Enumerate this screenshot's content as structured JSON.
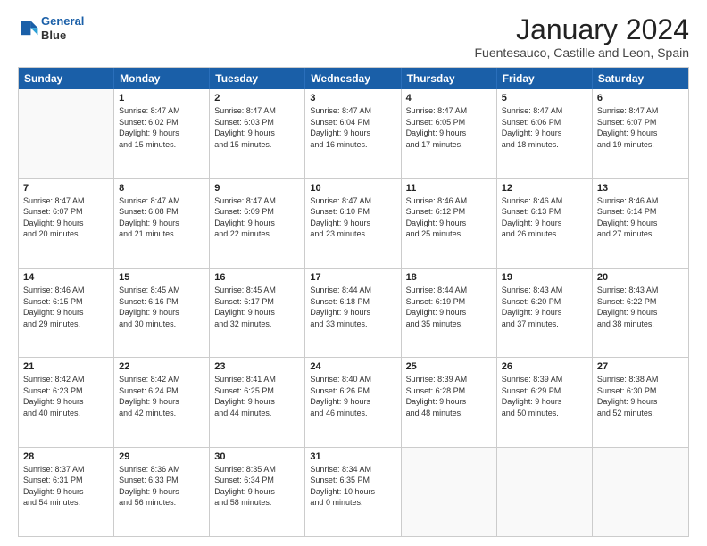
{
  "logo": {
    "line1": "General",
    "line2": "Blue"
  },
  "title": "January 2024",
  "subtitle": "Fuentesauco, Castille and Leon, Spain",
  "weekdays": [
    "Sunday",
    "Monday",
    "Tuesday",
    "Wednesday",
    "Thursday",
    "Friday",
    "Saturday"
  ],
  "rows": [
    [
      {
        "day": "",
        "info": ""
      },
      {
        "day": "1",
        "info": "Sunrise: 8:47 AM\nSunset: 6:02 PM\nDaylight: 9 hours\nand 15 minutes."
      },
      {
        "day": "2",
        "info": "Sunrise: 8:47 AM\nSunset: 6:03 PM\nDaylight: 9 hours\nand 15 minutes."
      },
      {
        "day": "3",
        "info": "Sunrise: 8:47 AM\nSunset: 6:04 PM\nDaylight: 9 hours\nand 16 minutes."
      },
      {
        "day": "4",
        "info": "Sunrise: 8:47 AM\nSunset: 6:05 PM\nDaylight: 9 hours\nand 17 minutes."
      },
      {
        "day": "5",
        "info": "Sunrise: 8:47 AM\nSunset: 6:06 PM\nDaylight: 9 hours\nand 18 minutes."
      },
      {
        "day": "6",
        "info": "Sunrise: 8:47 AM\nSunset: 6:07 PM\nDaylight: 9 hours\nand 19 minutes."
      }
    ],
    [
      {
        "day": "7",
        "info": "Sunrise: 8:47 AM\nSunset: 6:07 PM\nDaylight: 9 hours\nand 20 minutes."
      },
      {
        "day": "8",
        "info": "Sunrise: 8:47 AM\nSunset: 6:08 PM\nDaylight: 9 hours\nand 21 minutes."
      },
      {
        "day": "9",
        "info": "Sunrise: 8:47 AM\nSunset: 6:09 PM\nDaylight: 9 hours\nand 22 minutes."
      },
      {
        "day": "10",
        "info": "Sunrise: 8:47 AM\nSunset: 6:10 PM\nDaylight: 9 hours\nand 23 minutes."
      },
      {
        "day": "11",
        "info": "Sunrise: 8:46 AM\nSunset: 6:12 PM\nDaylight: 9 hours\nand 25 minutes."
      },
      {
        "day": "12",
        "info": "Sunrise: 8:46 AM\nSunset: 6:13 PM\nDaylight: 9 hours\nand 26 minutes."
      },
      {
        "day": "13",
        "info": "Sunrise: 8:46 AM\nSunset: 6:14 PM\nDaylight: 9 hours\nand 27 minutes."
      }
    ],
    [
      {
        "day": "14",
        "info": "Sunrise: 8:46 AM\nSunset: 6:15 PM\nDaylight: 9 hours\nand 29 minutes."
      },
      {
        "day": "15",
        "info": "Sunrise: 8:45 AM\nSunset: 6:16 PM\nDaylight: 9 hours\nand 30 minutes."
      },
      {
        "day": "16",
        "info": "Sunrise: 8:45 AM\nSunset: 6:17 PM\nDaylight: 9 hours\nand 32 minutes."
      },
      {
        "day": "17",
        "info": "Sunrise: 8:44 AM\nSunset: 6:18 PM\nDaylight: 9 hours\nand 33 minutes."
      },
      {
        "day": "18",
        "info": "Sunrise: 8:44 AM\nSunset: 6:19 PM\nDaylight: 9 hours\nand 35 minutes."
      },
      {
        "day": "19",
        "info": "Sunrise: 8:43 AM\nSunset: 6:20 PM\nDaylight: 9 hours\nand 37 minutes."
      },
      {
        "day": "20",
        "info": "Sunrise: 8:43 AM\nSunset: 6:22 PM\nDaylight: 9 hours\nand 38 minutes."
      }
    ],
    [
      {
        "day": "21",
        "info": "Sunrise: 8:42 AM\nSunset: 6:23 PM\nDaylight: 9 hours\nand 40 minutes."
      },
      {
        "day": "22",
        "info": "Sunrise: 8:42 AM\nSunset: 6:24 PM\nDaylight: 9 hours\nand 42 minutes."
      },
      {
        "day": "23",
        "info": "Sunrise: 8:41 AM\nSunset: 6:25 PM\nDaylight: 9 hours\nand 44 minutes."
      },
      {
        "day": "24",
        "info": "Sunrise: 8:40 AM\nSunset: 6:26 PM\nDaylight: 9 hours\nand 46 minutes."
      },
      {
        "day": "25",
        "info": "Sunrise: 8:39 AM\nSunset: 6:28 PM\nDaylight: 9 hours\nand 48 minutes."
      },
      {
        "day": "26",
        "info": "Sunrise: 8:39 AM\nSunset: 6:29 PM\nDaylight: 9 hours\nand 50 minutes."
      },
      {
        "day": "27",
        "info": "Sunrise: 8:38 AM\nSunset: 6:30 PM\nDaylight: 9 hours\nand 52 minutes."
      }
    ],
    [
      {
        "day": "28",
        "info": "Sunrise: 8:37 AM\nSunset: 6:31 PM\nDaylight: 9 hours\nand 54 minutes."
      },
      {
        "day": "29",
        "info": "Sunrise: 8:36 AM\nSunset: 6:33 PM\nDaylight: 9 hours\nand 56 minutes."
      },
      {
        "day": "30",
        "info": "Sunrise: 8:35 AM\nSunset: 6:34 PM\nDaylight: 9 hours\nand 58 minutes."
      },
      {
        "day": "31",
        "info": "Sunrise: 8:34 AM\nSunset: 6:35 PM\nDaylight: 10 hours\nand 0 minutes."
      },
      {
        "day": "",
        "info": ""
      },
      {
        "day": "",
        "info": ""
      },
      {
        "day": "",
        "info": ""
      }
    ]
  ]
}
